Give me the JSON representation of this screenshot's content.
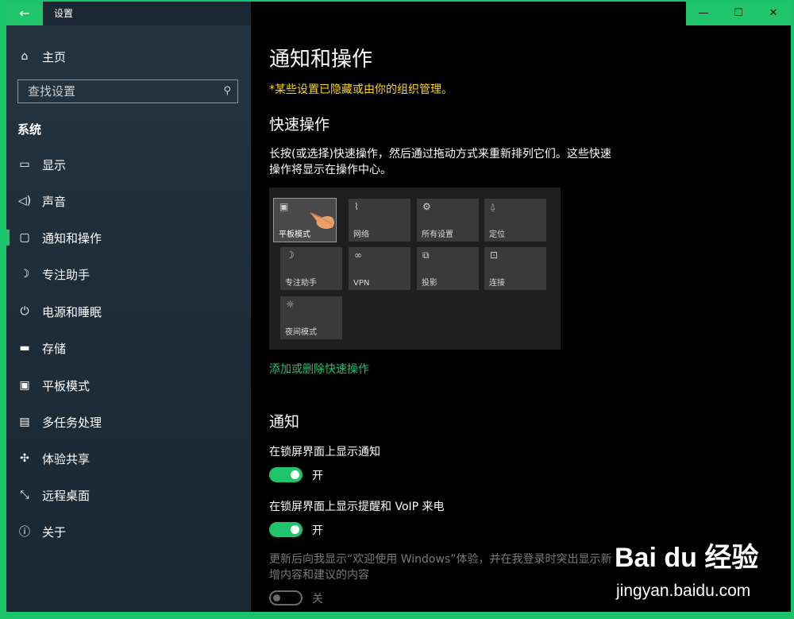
{
  "window": {
    "title": "设置",
    "back_icon": "back-arrow-icon",
    "controls": [
      "—",
      "☐",
      "✕"
    ]
  },
  "sidebar": {
    "home": {
      "label": "主页",
      "icon": "home-icon"
    },
    "search_placeholder": "查找设置",
    "section": "系统",
    "items": [
      {
        "label": "显示",
        "icon": "display-icon"
      },
      {
        "label": "声音",
        "icon": "speaker-icon"
      },
      {
        "label": "通知和操作",
        "icon": "notification-icon",
        "active": true
      },
      {
        "label": "专注助手",
        "icon": "moon-icon"
      },
      {
        "label": "电源和睡眠",
        "icon": "power-icon"
      },
      {
        "label": "存储",
        "icon": "storage-icon"
      },
      {
        "label": "平板模式",
        "icon": "tablet-icon"
      },
      {
        "label": "多任务处理",
        "icon": "multitask-icon"
      },
      {
        "label": "体验共享",
        "icon": "share-icon"
      },
      {
        "label": "远程桌面",
        "icon": "remote-icon"
      },
      {
        "label": "关于",
        "icon": "info-icon"
      }
    ]
  },
  "main": {
    "title": "通知和操作",
    "warning": "*某些设置已隐藏或由你的组织管理。",
    "quick_actions": {
      "heading": "快速操作",
      "description": "长按(或选择)快速操作，然后通过拖动方式来重新排列它们。这些快速操作将显示在操作中心。",
      "tiles": [
        {
          "label": "平板模式",
          "icon": "tablet-icon"
        },
        {
          "label": "网络",
          "icon": "network-icon"
        },
        {
          "label": "所有设置",
          "icon": "gear-icon"
        },
        {
          "label": "定位",
          "icon": "location-icon"
        },
        {
          "label": "专注助手",
          "icon": "moon-icon"
        },
        {
          "label": "VPN",
          "icon": "vpn-icon"
        },
        {
          "label": "投影",
          "icon": "project-icon"
        },
        {
          "label": "连接",
          "icon": "connect-icon"
        },
        {
          "label": "夜间模式",
          "icon": "brightness-icon"
        }
      ],
      "link": "添加或删除快速操作"
    },
    "notifications": {
      "heading": "通知",
      "settings": [
        {
          "label": "在锁屏界面上显示通知",
          "state": "开",
          "on": true
        },
        {
          "label": "在锁屏界面上显示提醒和 VoIP 来电",
          "state": "开",
          "on": true
        },
        {
          "label": "更新后向我显示“欢迎使用 Windows”体验，并在我登录时突出显示新增内容和建议的内容",
          "state": "关",
          "on": false
        }
      ]
    }
  },
  "watermark": {
    "logo": "Bai du 经验",
    "url": "jingyan.baidu.com"
  }
}
